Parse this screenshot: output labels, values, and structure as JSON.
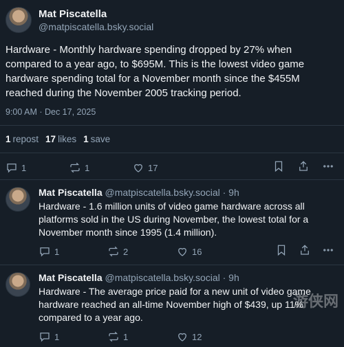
{
  "main_post": {
    "author": {
      "display_name": "Mat Piscatella",
      "handle": "@matpiscatella.bsky.social"
    },
    "text": "Hardware - Monthly hardware spending dropped by 27% when compared to a year ago, to $695M. This is the lowest video game hardware spending total for a November month since the $455M reached during the November 2005 tracking period.",
    "timestamp": "9:00 AM · Dec 17, 2025",
    "stats": {
      "reposts_count": "1",
      "reposts_label": "repost",
      "likes_count": "17",
      "likes_label": "likes",
      "saves_count": "1",
      "saves_label": "save"
    },
    "actions": {
      "reply_count": "1",
      "repost_count": "1",
      "like_count": "17"
    }
  },
  "replies": [
    {
      "display_name": "Mat Piscatella",
      "handle": "@matpiscatella.bsky.social",
      "time": "· 9h",
      "text": "Hardware - 1.6 million units of video game hardware across all platforms sold in the US during November, the lowest total for a November month since 1995 (1.4 million).",
      "reply_count": "1",
      "repost_count": "2",
      "like_count": "16"
    },
    {
      "display_name": "Mat Piscatella",
      "handle": "@matpiscatella.bsky.social",
      "time": "· 9h",
      "text": "Hardware - The average price paid for a new unit of video game hardware reached an all-time November high of $439, up 11% compared to a year ago.",
      "reply_count": "1",
      "repost_count": "1",
      "like_count": "12"
    }
  ],
  "watermark": "游侠网",
  "icons": [
    "reply-icon",
    "repost-icon",
    "like-icon",
    "bookmark-icon",
    "share-icon",
    "more-icon"
  ]
}
